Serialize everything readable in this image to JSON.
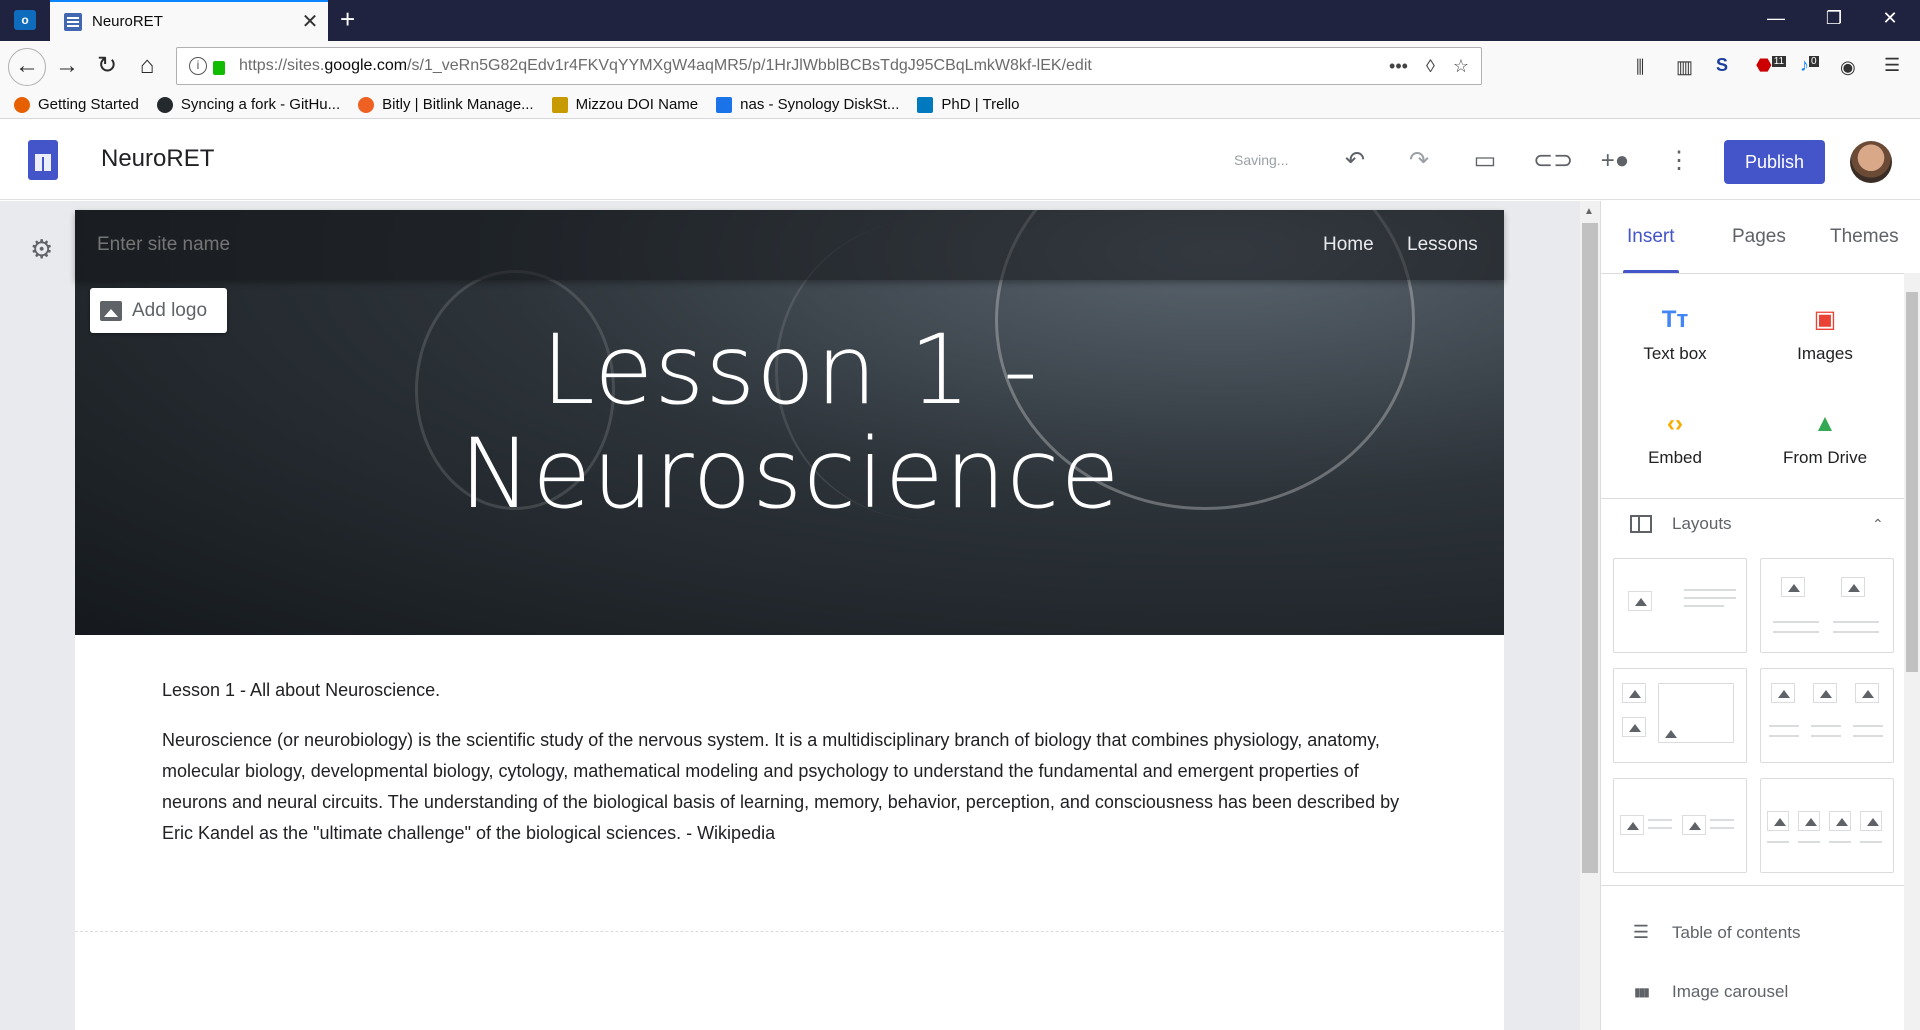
{
  "browser": {
    "tab_title": "NeuroRET",
    "tab_close": "✕",
    "new_tab": "+",
    "window_controls": [
      "—",
      "❐",
      "✕"
    ],
    "url_host_prefix": "https://sites.",
    "url_host": "google.com",
    "url_path": "/s/1_veRn5G82qEdv1r4FKVqYYMXgW4aqMR5/p/1HrJlWbblBCBsTdgJ95CBqLmkW8kf-lEK/edit",
    "bookmarks": [
      {
        "label": "Getting Started",
        "color": "#e66000"
      },
      {
        "label": "Syncing a fork - GitHu...",
        "color": "#24292e"
      },
      {
        "label": "Bitly | Bitlink Manage...",
        "color": "#ee6123"
      },
      {
        "label": "Mizzou DOI Name",
        "color": "#c79b00"
      },
      {
        "label": "nas - Synology DiskSt...",
        "color": "#1a73e8"
      },
      {
        "label": "PhD | Trello",
        "color": "#0079bf"
      }
    ],
    "toolbar_badges": {
      "abp": "11",
      "notif": "0"
    }
  },
  "sites_header": {
    "title": "NeuroRET",
    "status": "Saving...",
    "publish_label": "Publish"
  },
  "page": {
    "site_name_placeholder": "Enter site name",
    "nav": [
      "Home",
      "Lessons"
    ],
    "add_logo_label": "Add logo",
    "banner_title_line1": "Lesson 1 -",
    "banner_title_line2": "Neuroscience",
    "subtitle": "Lesson 1 - All about Neuroscience.",
    "body": "Neuroscience (or neurobiology) is the scientific study of the nervous system. It is a multidisciplinary branch of biology that combines physiology, anatomy, molecular biology, developmental biology, cytology, mathematical modeling and psychology to understand the fundamental and emergent properties of neurons and neural circuits. The understanding of the biological basis of learning, memory, behavior, perception, and consciousness has been described by Eric Kandel as the \"ultimate challenge\" of the biological sciences. - Wikipedia"
  },
  "panel": {
    "tabs": [
      "Insert",
      "Pages",
      "Themes"
    ],
    "insert_items": [
      {
        "label": "Text box",
        "icon": "text-box-icon",
        "glyph": "Tт",
        "color": "#4285f4"
      },
      {
        "label": "Images",
        "icon": "image-icon",
        "glyph": "▣",
        "color": "#ea4335"
      },
      {
        "label": "Embed",
        "icon": "embed-icon",
        "glyph": "‹›",
        "color": "#f9ab00"
      },
      {
        "label": "From Drive",
        "icon": "drive-icon",
        "glyph": "▲",
        "color": "#34a853"
      }
    ],
    "layouts_label": "Layouts",
    "items": [
      {
        "label": "Table of contents",
        "icon": "list-icon",
        "glyph": "☰"
      },
      {
        "label": "Image carousel",
        "icon": "carousel-icon",
        "glyph": "▮▮▮"
      }
    ]
  },
  "colors": {
    "accent": "#4355c9",
    "banner_dark": "#1f2428"
  }
}
